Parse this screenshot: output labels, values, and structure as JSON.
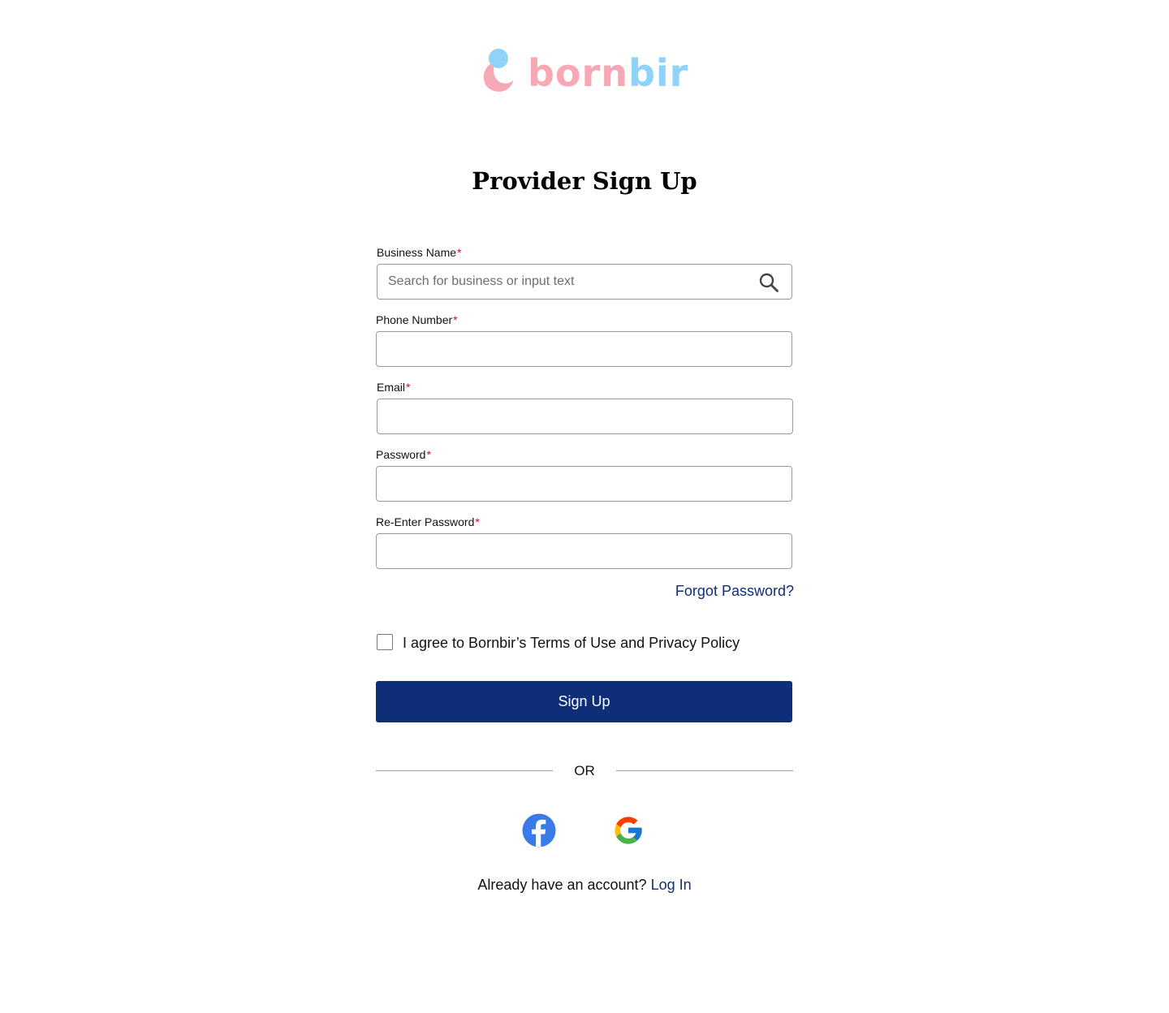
{
  "brand": {
    "name_part_a": "born",
    "name_part_b": "bir",
    "colors": {
      "pink": "#f6a8b5",
      "blue": "#8fd3f8"
    }
  },
  "title": "Provider Sign Up",
  "form": {
    "required_marker": "*",
    "business_name": {
      "label": "Business Name",
      "placeholder": "Search for business or input text",
      "value": "",
      "icon": "search-icon"
    },
    "phone_number": {
      "label": "Phone Number",
      "value": ""
    },
    "email": {
      "label": "Email",
      "value": ""
    },
    "password": {
      "label": "Password",
      "value": ""
    },
    "reenter_password": {
      "label": "Re-Enter Password",
      "value": ""
    },
    "forgot_password": "Forgot Password?",
    "agree_text": "I agree to Bornbir’s Terms of Use and Privacy Policy",
    "agree_checked": false,
    "submit_label": "Sign Up"
  },
  "divider_text": "OR",
  "social": {
    "facebook_icon": "facebook-icon",
    "google_icon": "google-icon",
    "facebook_color": "#3b7be8"
  },
  "footer": {
    "prompt": "Already have an account?",
    "login_link": "Log In"
  },
  "colors": {
    "primary": "#0e2f77",
    "required": "#c8102e"
  }
}
